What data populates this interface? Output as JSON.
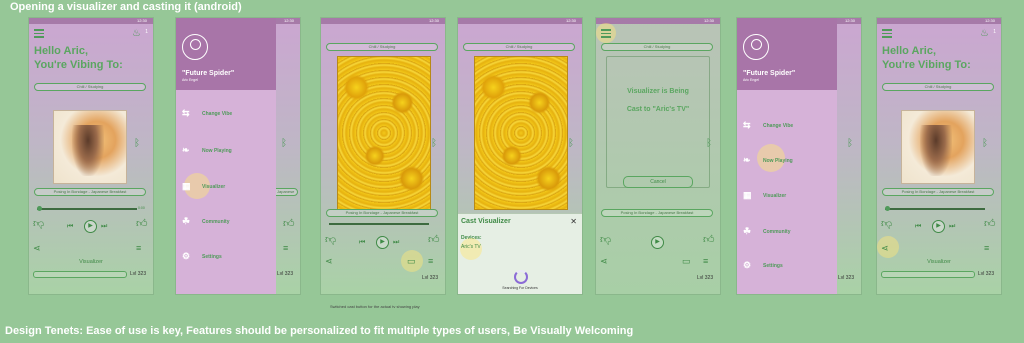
{
  "heading": "Opening a visualizer and casting it (android)",
  "footer": "Design Tenets: Ease of use is key, Features should be personalized to fit multiple types of users, Be Visually Welcoming",
  "note": "Switched cast button for the actual tv showing play",
  "status_time": "12:30",
  "flame_count": "1",
  "greeting": "Hello Aric,\nYou're Vibing To:",
  "vibe": "Chill / Studying",
  "song": "Posing In Bondage - Japanese Breakfast",
  "time_end": "0:00",
  "visualizer_label": "Visualizer",
  "level": "Lvl 323",
  "user_name": "\"Future Spider\"",
  "user_sub": "Aric Engel",
  "menu": [
    "Change Vibe",
    "Now Playing",
    "Visualizer",
    "Community",
    "Settings"
  ],
  "menu_icons": [
    "swap-icon",
    "leaf-icon",
    "equalizer-icon",
    "community-icon",
    "gear-icon"
  ],
  "cast_sheet": {
    "title": "Cast Visualizer",
    "devices_label": "Devices:",
    "device": "Aric's TV",
    "searching": "Searching For Devices"
  },
  "cast_text": "Visualizer is Being\nCast to \"Aric's TV\"",
  "cancel": "Cancel",
  "colors": {
    "background": "#96c797",
    "accent": "#5aa660",
    "drawer": "#d6b2d8",
    "drawer_head": "#a875a8"
  }
}
